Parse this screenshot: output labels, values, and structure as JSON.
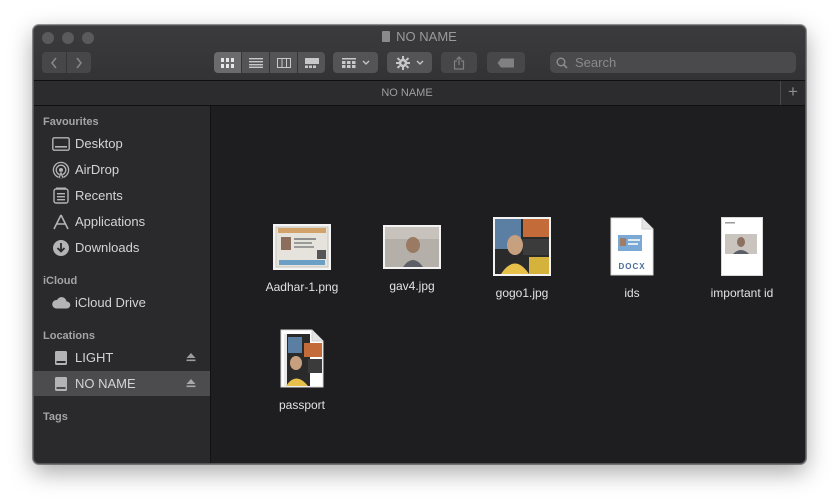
{
  "window": {
    "title": "NO NAME",
    "path_title": "NO NAME"
  },
  "toolbar": {
    "search_placeholder": "Search",
    "view_modes": [
      "icon-view",
      "list-view",
      "column-view",
      "gallery-view"
    ],
    "active_view": "icon-view"
  },
  "sidebar": {
    "favourites_header": "Favourites",
    "favourites": [
      {
        "label": "Desktop",
        "icon": "desktop-icon"
      },
      {
        "label": "AirDrop",
        "icon": "airdrop-icon"
      },
      {
        "label": "Recents",
        "icon": "recents-icon"
      },
      {
        "label": "Applications",
        "icon": "applications-icon"
      },
      {
        "label": "Downloads",
        "icon": "downloads-icon"
      }
    ],
    "icloud_header": "iCloud",
    "icloud": [
      {
        "label": "iCloud Drive",
        "icon": "cloud-icon"
      }
    ],
    "locations_header": "Locations",
    "locations": [
      {
        "label": "LIGHT",
        "icon": "drive-icon",
        "selected": false
      },
      {
        "label": "NO NAME",
        "icon": "drive-icon",
        "selected": true
      }
    ],
    "tags_header": "Tags"
  },
  "files": [
    {
      "name": "Aadhar-1.png"
    },
    {
      "name": "gav4.jpg"
    },
    {
      "name": "gogo1.jpg"
    },
    {
      "name": "ids",
      "badge": "DOCX"
    },
    {
      "name": "important id"
    },
    {
      "name": "passport"
    }
  ],
  "colors": {
    "window_bg": "#1e1e20",
    "sidebar_bg": "#2a2a2c",
    "selection": "#4c4c4f"
  }
}
